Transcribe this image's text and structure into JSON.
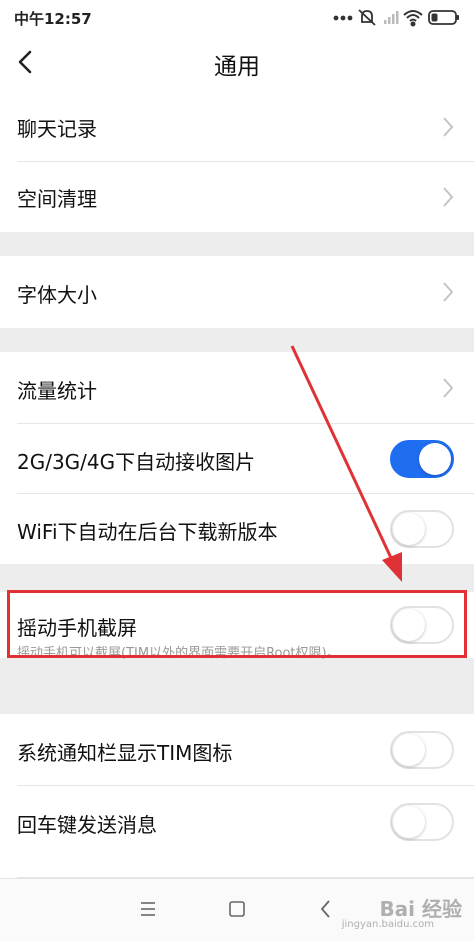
{
  "status_bar": {
    "time": "中午12:57",
    "icons": [
      "dots-icon",
      "mute-icon",
      "signal-icon",
      "wifi-icon",
      "battery-icon"
    ]
  },
  "header": {
    "title": "通用"
  },
  "sections": [
    {
      "items": [
        {
          "label": "聊天记录",
          "control": "chevron"
        },
        {
          "label": "空间清理",
          "control": "chevron"
        }
      ]
    },
    {
      "items": [
        {
          "label": "字体大小",
          "control": "chevron"
        }
      ]
    },
    {
      "items": [
        {
          "label": "流量统计",
          "control": "chevron"
        },
        {
          "label": "2G/3G/4G下自动接收图片",
          "control": "toggle",
          "on": true
        },
        {
          "label": "WiFi下自动在后台下载新版本",
          "control": "toggle",
          "on": false
        }
      ]
    },
    {
      "items": [
        {
          "label": "摇动手机截屏",
          "control": "toggle",
          "on": false
        }
      ],
      "hint": "摇动手机可以截屏(TIM以外的界面需要开启Root权限)。"
    },
    {
      "items": [
        {
          "label": "系统通知栏显示TIM图标",
          "control": "toggle",
          "on": false
        },
        {
          "label": "回车键发送消息",
          "control": "toggle",
          "on": false
        }
      ]
    }
  ],
  "colors": {
    "accent": "#1f6ef2",
    "annotation": "#e03234"
  },
  "system_nav": {
    "icons": [
      "menu-icon",
      "home-icon",
      "back-icon"
    ]
  },
  "watermark": {
    "text": "Bai 经验",
    "sub": "jingyan.baidu.com"
  }
}
